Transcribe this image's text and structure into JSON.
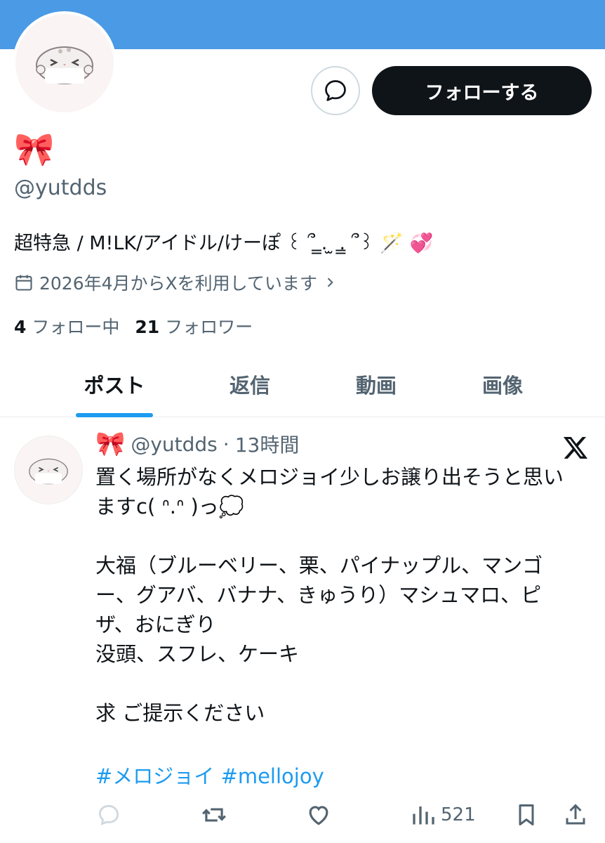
{
  "profile": {
    "display_name": "🎀",
    "handle": "@yutdds",
    "bio": "超特急 / M!LK/アイドル/けーぽ ꒰ ՞ ̳. ̫ .̳ ՞꒱ 🪄 💞",
    "joined": "2026年4月からXを利用しています",
    "following_count": "4",
    "following_label": "フォロー中",
    "followers_count": "21",
    "followers_label": "フォロワー",
    "follow_button": "フォローする"
  },
  "tabs": [
    {
      "label": "ポスト",
      "active": true
    },
    {
      "label": "返信",
      "active": false
    },
    {
      "label": "動画",
      "active": false
    },
    {
      "label": "画像",
      "active": false
    }
  ],
  "post": {
    "display_name": "🎀",
    "handle": "@yutdds",
    "separator": "·",
    "time": "13時間",
    "text": "置く場所がなくメロジョイ少しお譲り出そうと思いますc( ᐢ.ᐢ )っ💭\n\n大福（ブルーベリー、栗、パイナップル、マンゴー、グアバ、バナナ、きゅうり）マシュマロ、ピザ、おにぎり\n没頭、スフレ、ケーキ\n\n求 ご提示ください",
    "hashtags": "#メロジョイ #mellojoy",
    "views": "521"
  },
  "colors": {
    "banner": "#4a9ae6",
    "accent": "#1d9bf0",
    "text": "#0f1419",
    "secondary": "#536471"
  },
  "icons": [
    "message-icon",
    "calendar-icon",
    "chevron-right-icon",
    "x-logo-icon",
    "reply-icon",
    "repost-icon",
    "like-icon",
    "views-icon",
    "bookmark-icon",
    "share-icon"
  ]
}
